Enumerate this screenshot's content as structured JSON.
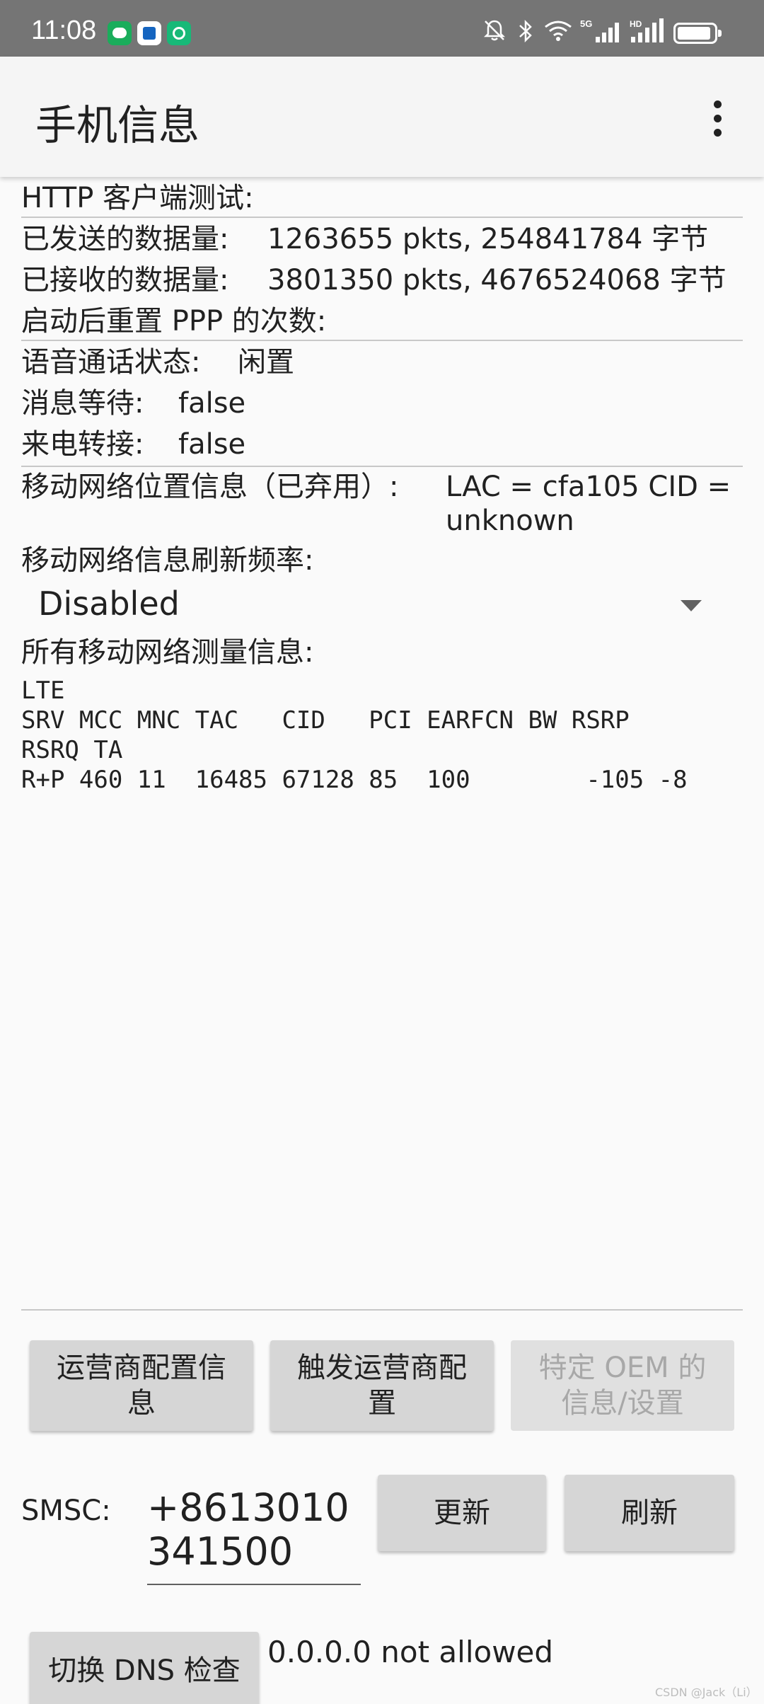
{
  "status_bar": {
    "time": "11:08",
    "app_icons": [
      "wechat-icon",
      "app-icon",
      "app-icon"
    ],
    "signal_5g_label": "5G",
    "signal_hd_label": "HD"
  },
  "app_bar": {
    "title": "手机信息",
    "menu_icon": "more-vert-icon"
  },
  "info": {
    "http_client_test": "HTTP 客户端测试:",
    "sent_label": "已发送的数据量:",
    "sent_value": "1263655 pkts, 254841784 字节",
    "received_label": "已接收的数据量:",
    "received_value": "3801350 pkts, 4676524068 字节",
    "ppp_reset_label": "启动后重置 PPP 的次数:",
    "voice_call_label": "语音通话状态:",
    "voice_call_value": "闲置",
    "message_waiting_label": "消息等待:",
    "message_waiting_value": "false",
    "call_forward_label": "来电转接:",
    "call_forward_value": "false",
    "cell_location_label": "移动网络位置信息（已弃用）:",
    "cell_location_value_line1": "LAC = cfa105   CID =",
    "cell_location_value_line2": "unknown",
    "refresh_rate_label": "移动网络信息刷新频率:",
    "refresh_rate_value": "Disabled",
    "measurements_label": "所有移动网络测量信息:",
    "measurements_line1": "LTE",
    "measurements_line2": "SRV MCC MNC TAC   CID   PCI EARFCN BW RSRP",
    "measurements_line3": "RSRQ TA",
    "measurements_line4": "R+P 460 11  16485 67128 85  100        -105 -8"
  },
  "buttons": {
    "carrier_config": "运营商配置信息",
    "trigger_carrier_config": "触发运营商配置",
    "oem_info": "特定 OEM 的信息/设置",
    "update": "更新",
    "refresh": "刷新",
    "toggle_dns": "切换 DNS 检查"
  },
  "smsc": {
    "label": "SMSC:",
    "value": "+8613010341500"
  },
  "dns_status": "0.0.0.0 not allowed",
  "watermark": "CSDN @Jack（Li）"
}
